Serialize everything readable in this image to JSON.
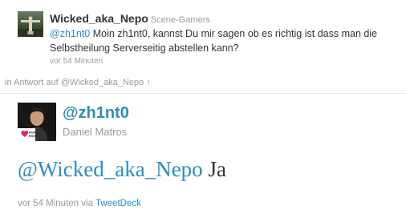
{
  "parent_tweet": {
    "screen_name": "Wicked_aka_Nepo",
    "full_name": "Scene-Gamers",
    "mention": "@zh1nt0",
    "text": " Moin zh1nt0, kannst Du mir sagen ob es richtig ist dass man die Selbstheilung Serverseitig abstellen kann?",
    "timestamp": "vor 54 Minuten"
  },
  "in_reply_to": {
    "prefix": "in Antwort auf ",
    "link": "@Wicked_aka_Nepo",
    "arrow": "↑"
  },
  "main_tweet": {
    "screen_name": "@zh1nt0",
    "full_name": "Daniel Matros",
    "avatar_badge": "HUMAN RIGHTS",
    "mention": "@Wicked_aka_Nepo",
    "text": " Ja",
    "timestamp": "vor 54 Minuten",
    "via": " via ",
    "source": "TweetDeck"
  },
  "colors": {
    "link": "#2a8dc4",
    "text": "#333333",
    "muted": "#999999",
    "badge_heart": "#e0245e"
  },
  "icons": {
    "parent_avatar": "christ-statue-avatar",
    "main_avatar": "profile-photo-avatar",
    "badge": "heart-icon"
  }
}
